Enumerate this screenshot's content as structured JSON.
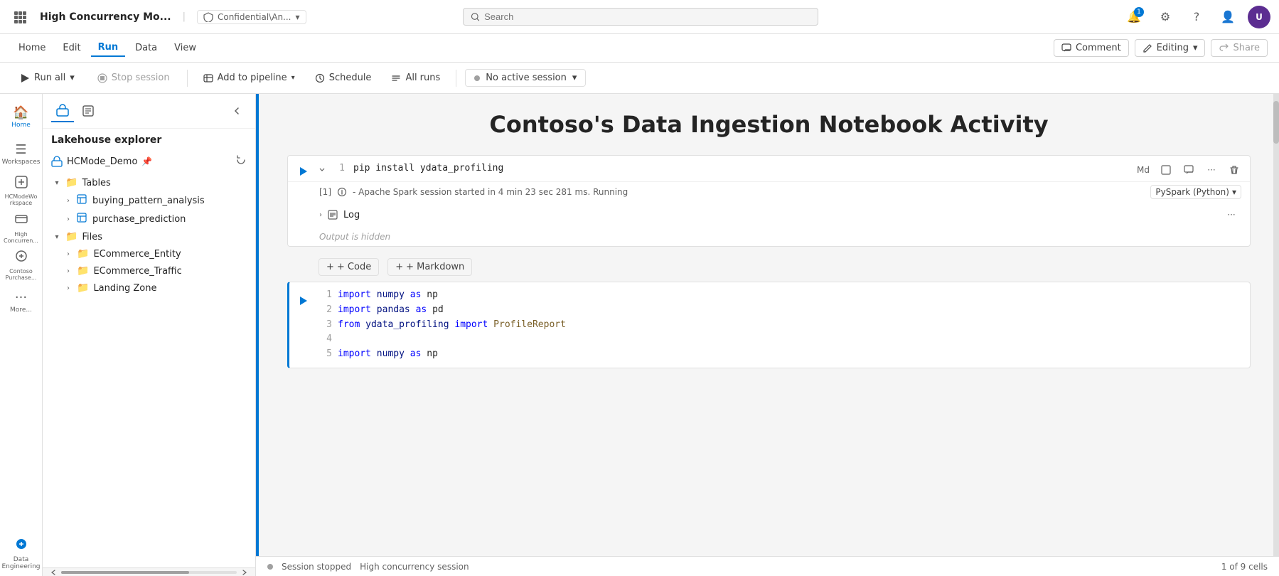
{
  "app": {
    "title": "High Concurrency Mo...",
    "sensitivity": "Confidential\\An...",
    "search_placeholder": "Search"
  },
  "topbar": {
    "notifications": "1",
    "avatar_initials": "U"
  },
  "menu": {
    "items": [
      "Home",
      "Edit",
      "Run",
      "Data",
      "View"
    ],
    "active": "Run",
    "comment_label": "Comment",
    "editing_label": "Editing",
    "share_label": "Share"
  },
  "toolbar": {
    "run_all": "Run all",
    "stop_session": "Stop session",
    "add_to_pipeline": "Add to pipeline",
    "schedule": "Schedule",
    "all_runs": "All runs",
    "no_active_session": "No active session"
  },
  "sidebar": {
    "items": [
      {
        "label": "Home",
        "icon": "⊞"
      },
      {
        "label": "Workspaces",
        "icon": "☰"
      },
      {
        "label": "HCModeWorkspace",
        "icon": "⊡"
      },
      {
        "label": "High Concurren...",
        "icon": "≡"
      },
      {
        "label": "Contoso Purchase...",
        "icon": "🛒"
      },
      {
        "label": "More...",
        "icon": "···"
      }
    ],
    "bottom": {
      "label": "Data Engineering",
      "icon": "⚙"
    }
  },
  "explorer": {
    "title": "Lakehouse explorer",
    "lakehouse_name": "HCMode_Demo",
    "tables_label": "Tables",
    "tables_items": [
      "buying_pattern_analysis",
      "purchase_prediction"
    ],
    "files_label": "Files",
    "files_items": [
      "ECommerce_Entity",
      "ECommerce_Traffic",
      "Landing Zone"
    ]
  },
  "notebook": {
    "title": "Contoso's Data Ingestion Notebook Activity",
    "cells": [
      {
        "line_num": "1",
        "code": "pip install ydata_profiling",
        "exec_badge": "[1]",
        "exec_info": "- Apache Spark session started in 4 min 23 sec 281 ms. Running",
        "pyspark": "PySpark (Python)",
        "log_label": "Log",
        "output_hidden": "Output is hidden"
      }
    ],
    "code_cell": {
      "lines": [
        {
          "num": "1",
          "content": "import numpy as np"
        },
        {
          "num": "2",
          "content": "import pandas as pd"
        },
        {
          "num": "3",
          "content": "from ydata_profiling import ProfileReport"
        },
        {
          "num": "4",
          "content": ""
        },
        {
          "num": "5",
          "content": "import numpy as np"
        }
      ]
    },
    "add_code": "+ Code",
    "add_markdown": "+ Markdown"
  },
  "statusbar": {
    "dot_label": "Session stopped",
    "concurrency_label": "High concurrency session",
    "cells_info": "1 of 9 cells"
  }
}
